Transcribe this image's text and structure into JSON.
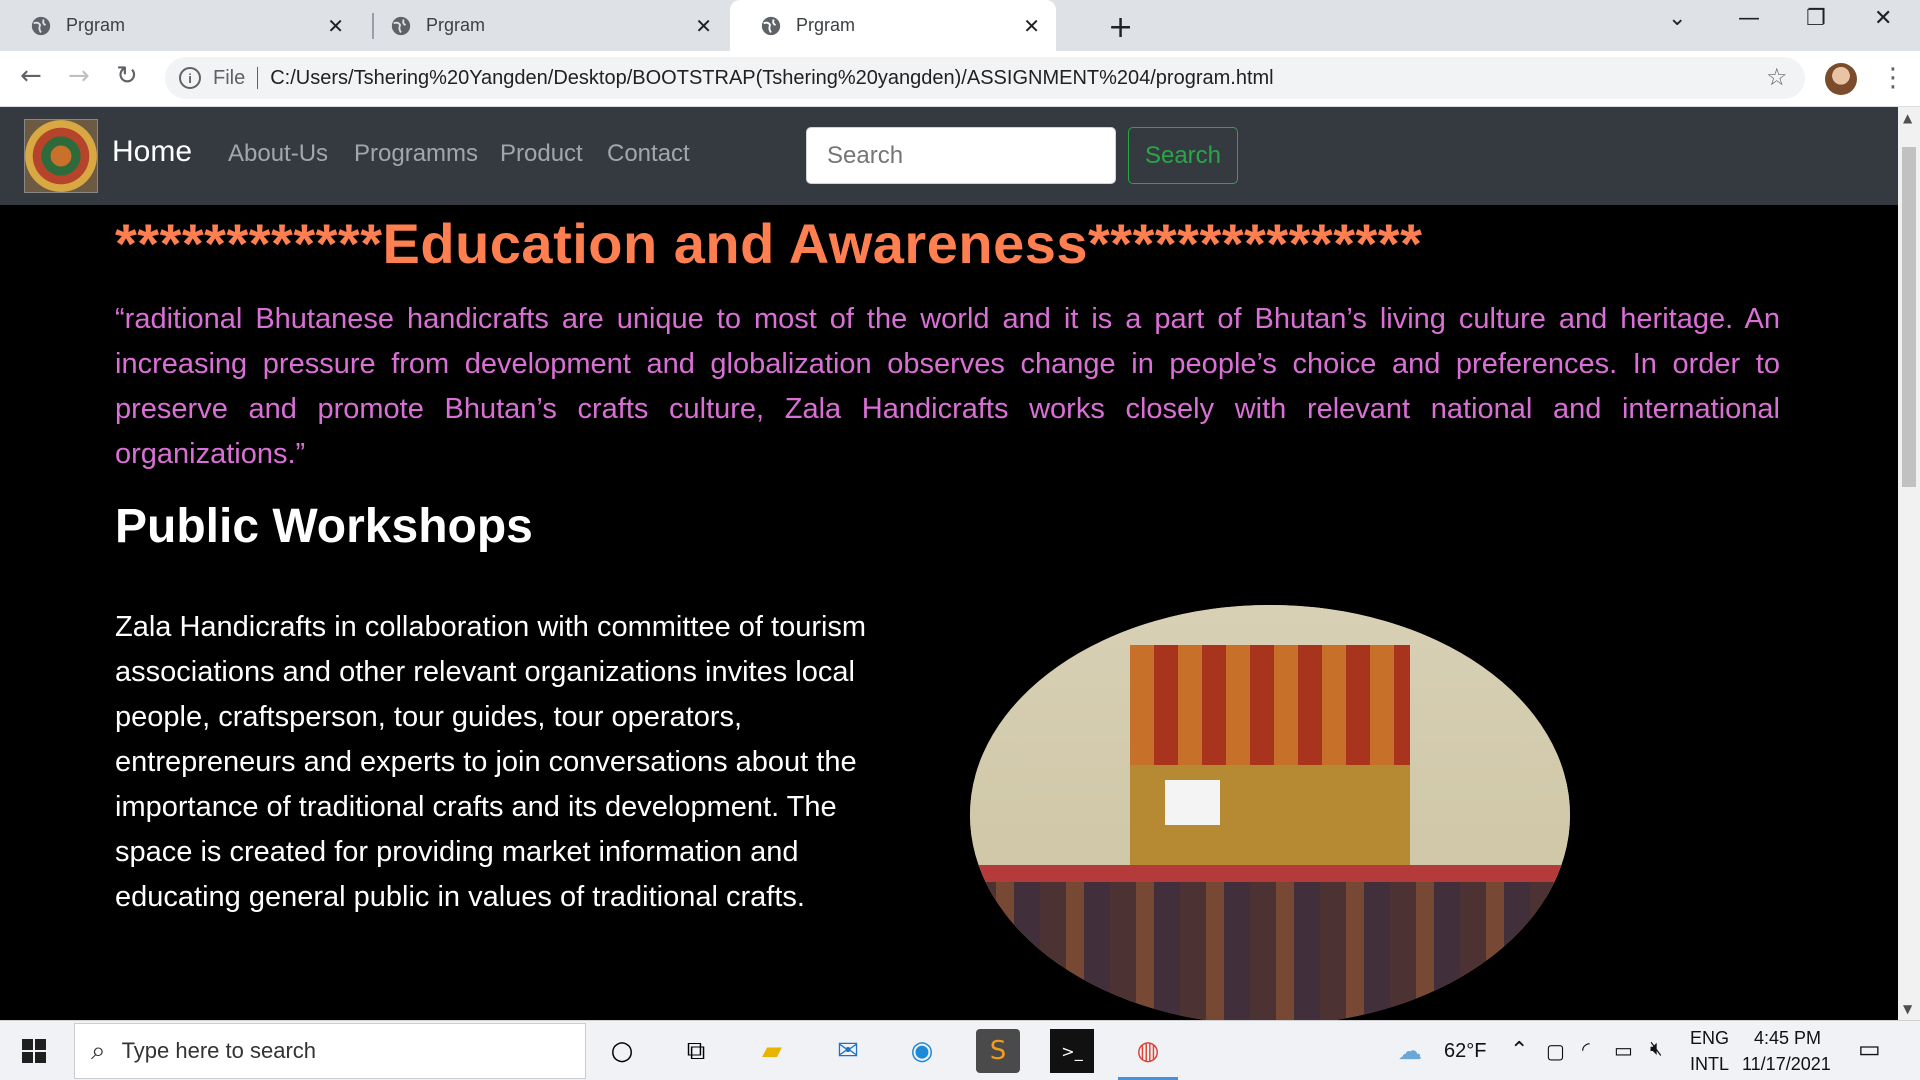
{
  "browser": {
    "tabs": [
      {
        "title": "Prgram"
      },
      {
        "title": "Prgram"
      },
      {
        "title": "Prgram"
      }
    ],
    "address": {
      "scheme_label": "File",
      "url": "C:/Users/Tshering%20Yangden/Desktop/BOOTSTRAP(Tshering%20yangden)/ASSIGNMENT%204/program.html"
    }
  },
  "navbar": {
    "brand": "Home",
    "links": [
      "About-Us",
      "Programms",
      "Product",
      "Contact"
    ],
    "search_placeholder": "Search",
    "search_button": "Search"
  },
  "content": {
    "heading": "************Education and Awareness***************",
    "intro": "“raditional Bhutanese handicrafts are unique to most of the world and it is a part of Bhutan’s living culture and heritage. An increasing pressure from development and globalization observes change in people’s choice and preferences. In order to preserve and promote Bhutan’s crafts culture, Zala Handicrafts works closely with relevant national and international organizations.”",
    "section_title": "Public Workshops",
    "section_body": "Zala Handicrafts in collaboration with committee of tourism associations and other relevant organizations invites local people, craftsperson, tour guides, tour operators, entrepreneurs and experts to join conversations about the importance of traditional crafts and its development. The space is created for providing market information and educating general public in values of traditional crafts."
  },
  "taskbar": {
    "search_placeholder": "Type here to search",
    "weather": "62°F",
    "language_top": "ENG",
    "language_bottom": "INTL",
    "time": "4:45 PM",
    "date": "11/17/2021"
  },
  "colors": {
    "heading": "#ff7f50",
    "intro": "#da70d6",
    "navbar_bg": "#343a40",
    "search_button": "#28a745"
  }
}
